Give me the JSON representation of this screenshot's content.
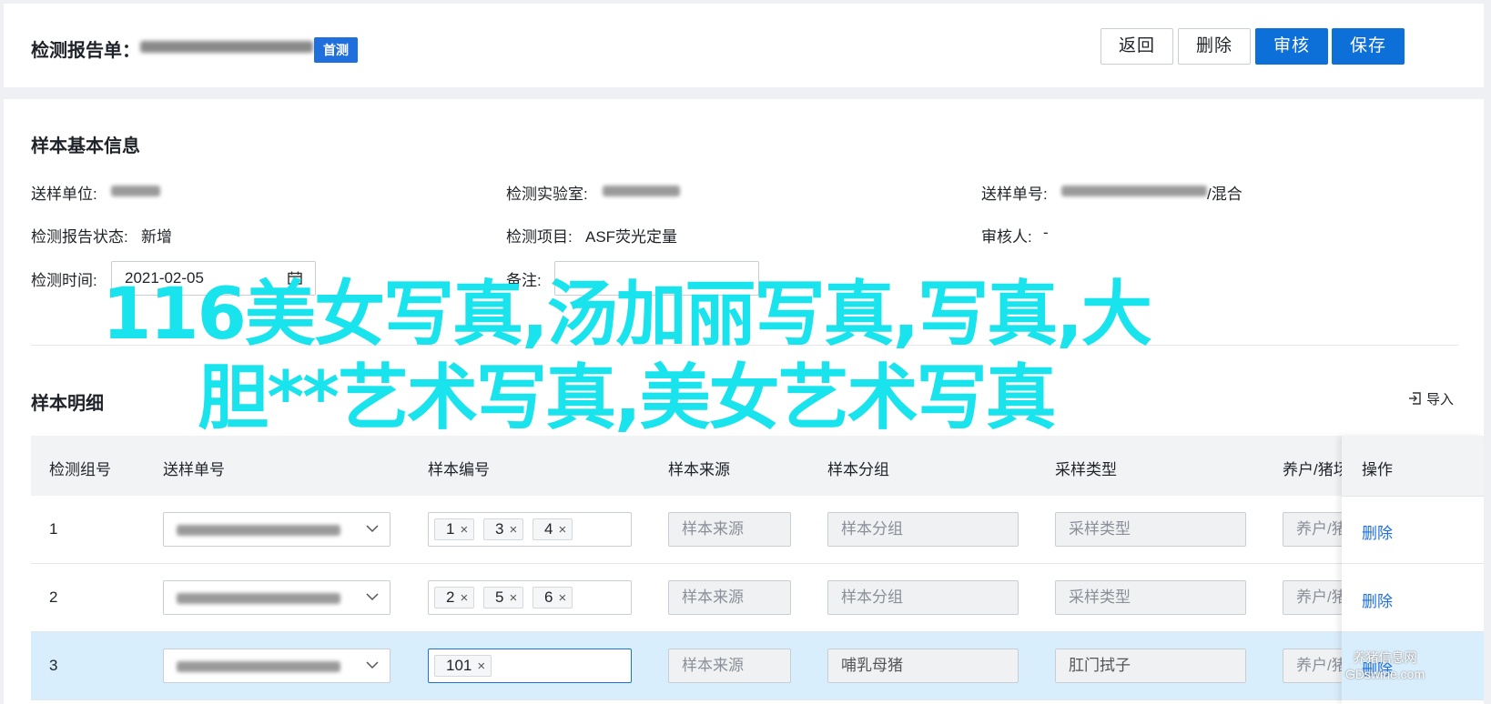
{
  "header": {
    "title": "检测报告单：",
    "badge": "首测",
    "buttons": {
      "back": "返回",
      "delete": "删除",
      "review": "审核",
      "save": "保存"
    }
  },
  "basic_info": {
    "section_title": "样本基本信息",
    "sender_unit_label": "送样单位:",
    "lab_label": "检测实验室:",
    "send_no_label": "送样单号:",
    "send_no_suffix": "/混合",
    "report_status_label": "检测报告状态:",
    "report_status_value": "新增",
    "test_item_label": "检测项目:",
    "test_item_value": "ASF荧光定量",
    "reviewer_label": "审核人:",
    "reviewer_value": "-",
    "test_time_label": "检测时间:",
    "test_time_value": "2021-02-05",
    "note_label": "备注:"
  },
  "detail": {
    "section_title": "样本明细",
    "import_label": "导入",
    "columns": [
      "检测组号",
      "送样单号",
      "样本编号",
      "样本来源",
      "样本分组",
      "采样类型",
      "养户/猪场",
      "操作"
    ],
    "rows": [
      {
        "no": "1",
        "tags": [
          "1",
          "3",
          "4"
        ],
        "source": "样本来源",
        "group": "样本分组",
        "type": "采样类型",
        "farm": "养户/猪场",
        "op": "删除"
      },
      {
        "no": "2",
        "tags": [
          "2",
          "5",
          "6"
        ],
        "source": "样本来源",
        "group": "样本分组",
        "type": "采样类型",
        "farm": "养户/猪场",
        "op": "删除"
      },
      {
        "no": "3",
        "tags": [
          "101"
        ],
        "source": "样本来源",
        "group": "哺乳母猪",
        "type": "肛门拭子",
        "farm": "养户/猪场",
        "op": "删除"
      }
    ],
    "tag_remove_glyph": "×"
  },
  "overlay": {
    "text_line1": "116美女写真,汤加丽写真,写真,大",
    "text_line2": "胆**艺术写真,美女艺术写真",
    "color": "#19e3ec"
  },
  "watermark": {
    "line1": "养猪信息网",
    "line2": "GDswine.com"
  },
  "colors": {
    "primary": "#0d6fd8",
    "selected_row": "#d9eefc",
    "link": "#1f6fdc"
  }
}
